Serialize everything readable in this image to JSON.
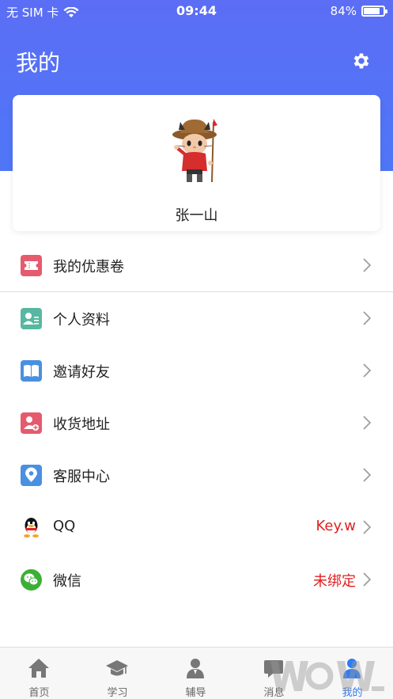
{
  "status": {
    "carrier": "无 SIM 卡",
    "time": "09:44",
    "battery": "84%",
    "battery_level": 0.84
  },
  "header": {
    "title": "我的"
  },
  "profile": {
    "name": "张一山"
  },
  "menu": [
    {
      "label": "我的优惠卷",
      "value": "",
      "icon": "coupon-icon",
      "color": "#e65a6e"
    },
    {
      "label": "个人资料",
      "value": "",
      "icon": "profile-card-icon",
      "color": "#58b7a0"
    },
    {
      "label": "邀请好友",
      "value": "",
      "icon": "book-icon",
      "color": "#4a90e2"
    },
    {
      "label": "收货地址",
      "value": "",
      "icon": "address-icon",
      "color": "#e65a6e"
    },
    {
      "label": "客服中心",
      "value": "",
      "icon": "location-pin-icon",
      "color": "#4a90e2"
    },
    {
      "label": "QQ",
      "value": "Key.w",
      "icon": "qq-icon",
      "color": "#000000"
    },
    {
      "label": "微信",
      "value": "未绑定",
      "icon": "wechat-icon",
      "color": "#3cb034"
    }
  ],
  "tabs": [
    {
      "label": "首页",
      "icon": "home-icon"
    },
    {
      "label": "学习",
      "icon": "graduation-cap-icon"
    },
    {
      "label": "辅导",
      "icon": "tutor-icon"
    },
    {
      "label": "消息",
      "icon": "message-icon"
    },
    {
      "label": "我的",
      "icon": "person-icon",
      "active": true
    }
  ],
  "colors": {
    "header_blue": "#5b6ef5",
    "accent_red": "#e02020",
    "tab_active": "#2f7bf5"
  }
}
